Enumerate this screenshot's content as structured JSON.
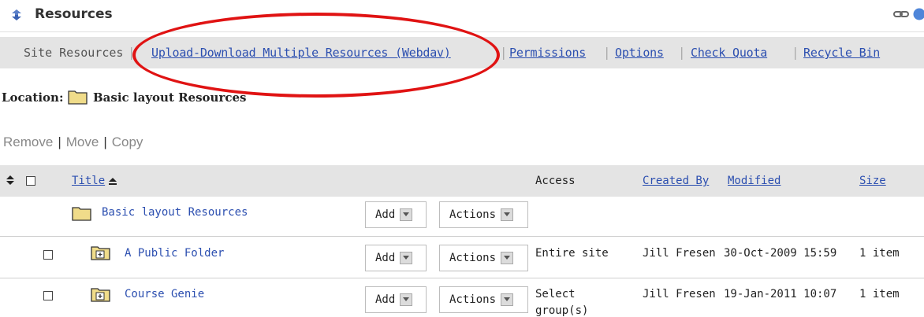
{
  "header": {
    "title": "Resources",
    "tool_icon": "refresh-arrows-icon",
    "link_icon": "link-icon",
    "help_icon": "help-icon"
  },
  "nav": {
    "current": "Site Resources",
    "links": [
      "Upload-Download Multiple Resources (Webdav)",
      "Permissions",
      "Options",
      "Check Quota",
      "Recycle Bin"
    ]
  },
  "location": {
    "label": "Location:",
    "name": "Basic layout Resources"
  },
  "actions": {
    "remove": "Remove",
    "move": "Move",
    "copy": "Copy",
    "separator": "|"
  },
  "table": {
    "headers": {
      "title": "Title",
      "access": "Access",
      "created_by": "Created By",
      "modified": "Modified",
      "size": "Size"
    },
    "add_label": "Add",
    "actions_label": "Actions",
    "root": {
      "title": "Basic layout Resources"
    },
    "rows": [
      {
        "title": "A Public Folder",
        "access": "Entire site",
        "created_by": "Jill Fresen",
        "modified": "30-Oct-2009 15:59",
        "size": "1 item"
      },
      {
        "title": "Course Genie",
        "access": "Select",
        "access_line2": "group(s)",
        "created_by": "Jill Fresen",
        "modified": "19-Jan-2011 10:07",
        "size": "1 item"
      }
    ]
  },
  "colors": {
    "link": "#2c4fb0",
    "bar": "#e4e4e4",
    "highlight_oval": "#e01313",
    "folder": "#f0dc8a"
  }
}
